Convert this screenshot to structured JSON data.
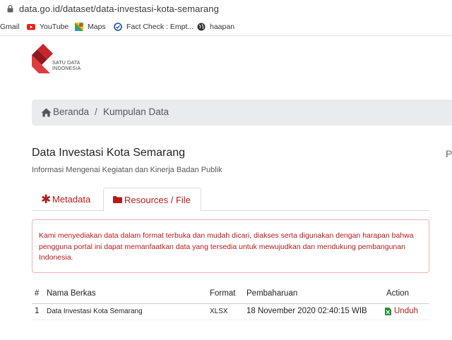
{
  "browser": {
    "url": "data.go.id/dataset/data-investasi-kota-semarang",
    "bookmarks": [
      {
        "label": "Gmail",
        "icon": "gmail-icon"
      },
      {
        "label": "YouTube",
        "icon": "youtube-icon"
      },
      {
        "label": "Maps",
        "icon": "maps-icon"
      },
      {
        "label": "Fact Check : Empt...",
        "icon": "fact-check-icon"
      },
      {
        "label": "haapan",
        "icon": "globe-icon"
      }
    ]
  },
  "logo": {
    "line1": "SATU DATA",
    "line2": "INDONESIA"
  },
  "breadcrumb": {
    "home": "Beranda",
    "separator": "/",
    "current": "Kumpulan Data"
  },
  "page": {
    "title": "Data Investasi Kota Semarang",
    "subtitle": "Informasi Mengenai Kegiatan dan Kinerja Badan Publik",
    "right_fragment": "P"
  },
  "tabs": [
    {
      "label": "Metadata",
      "icon": "asterisk-icon",
      "active": false
    },
    {
      "label": "Resources / File",
      "icon": "folder-icon",
      "active": true
    }
  ],
  "alert": {
    "text": "Kami menyediakan data dalam format terbuka dan mudah dicari, diakses serta digunakan dengan harapan bahwa pengguna portal ini dapat memanfaatkan data yang tersedia untuk mewujudkan dan mendukung pembangunan Indonesia."
  },
  "table": {
    "headers": [
      "#",
      "Nama Berkas",
      "Format",
      "Pembaharuan",
      "Action"
    ],
    "rows": [
      {
        "no": "1",
        "name": "Data Investasi Kota Semarang",
        "format": "XLSX",
        "updated": "18 November 2020 02:40:15 WIB",
        "action": "Unduh"
      }
    ]
  },
  "colors": {
    "accent": "#b31b1b",
    "breadcrumb_bg": "#e9ecef",
    "alert_border": "#f1b0b7"
  }
}
